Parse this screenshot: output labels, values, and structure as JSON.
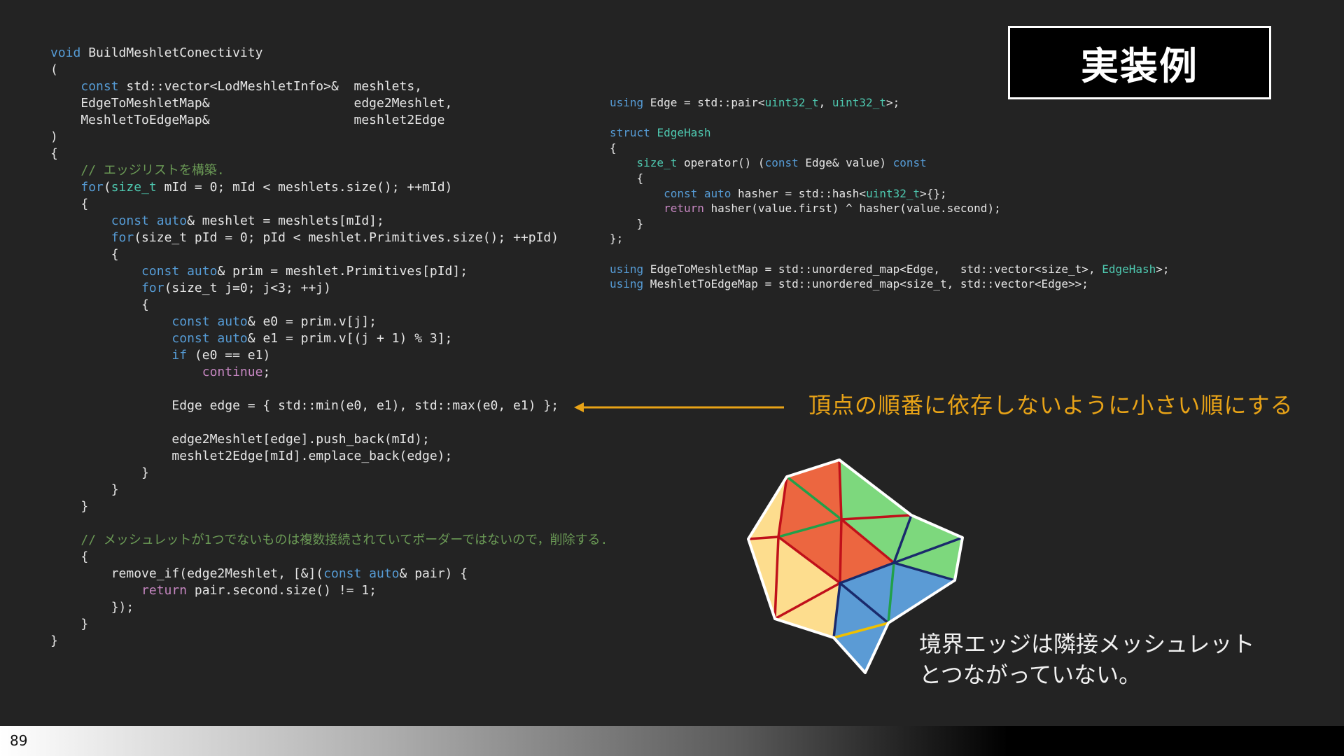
{
  "slide": {
    "title": "実装例",
    "page_number": "89"
  },
  "left_code": {
    "lines": [
      [
        {
          "t": "void",
          "c": "kw"
        },
        {
          "t": " BuildMeshletConectivity"
        }
      ],
      [
        {
          "t": "("
        }
      ],
      [
        {
          "t": "    "
        },
        {
          "t": "const",
          "c": "kw"
        },
        {
          "t": " std::vector<LodMeshletInfo>&  meshlets,"
        }
      ],
      [
        {
          "t": "    EdgeToMeshletMap&                   edge2Meshlet,"
        }
      ],
      [
        {
          "t": "    MeshletToEdgeMap&                   meshlet2Edge"
        }
      ],
      [
        {
          "t": ")"
        }
      ],
      [
        {
          "t": "{"
        }
      ],
      [
        {
          "t": "    "
        },
        {
          "t": "// エッジリストを構築.",
          "c": "cm"
        }
      ],
      [
        {
          "t": "    "
        },
        {
          "t": "for",
          "c": "kw"
        },
        {
          "t": "("
        },
        {
          "t": "size_t",
          "c": "ty"
        },
        {
          "t": " mId = 0; mId < meshlets.size(); ++mId)"
        }
      ],
      [
        {
          "t": "    {"
        }
      ],
      [
        {
          "t": "        "
        },
        {
          "t": "const",
          "c": "kw"
        },
        {
          "t": " "
        },
        {
          "t": "auto",
          "c": "kw"
        },
        {
          "t": "& meshlet = meshlets[mId];"
        }
      ],
      [
        {
          "t": "        "
        },
        {
          "t": "for",
          "c": "kw"
        },
        {
          "t": "(size_t pId = 0; pId < meshlet.Primitives.size(); ++pId)"
        }
      ],
      [
        {
          "t": "        {"
        }
      ],
      [
        {
          "t": "            "
        },
        {
          "t": "const",
          "c": "kw"
        },
        {
          "t": " "
        },
        {
          "t": "auto",
          "c": "kw"
        },
        {
          "t": "& prim = meshlet.Primitives[pId];"
        }
      ],
      [
        {
          "t": "            "
        },
        {
          "t": "for",
          "c": "kw"
        },
        {
          "t": "(size_t j=0; j<3; ++j)"
        }
      ],
      [
        {
          "t": "            {"
        }
      ],
      [
        {
          "t": "                "
        },
        {
          "t": "const",
          "c": "kw"
        },
        {
          "t": " "
        },
        {
          "t": "auto",
          "c": "kw"
        },
        {
          "t": "& e0 = prim.v[j];"
        }
      ],
      [
        {
          "t": "                "
        },
        {
          "t": "const",
          "c": "kw"
        },
        {
          "t": " "
        },
        {
          "t": "auto",
          "c": "kw"
        },
        {
          "t": "& e1 = prim.v[(j + 1) % 3];"
        }
      ],
      [
        {
          "t": "                "
        },
        {
          "t": "if",
          "c": "kw"
        },
        {
          "t": " (e0 == e1)"
        }
      ],
      [
        {
          "t": "                    "
        },
        {
          "t": "continue",
          "c": "ctl"
        },
        {
          "t": ";"
        }
      ],
      [
        {
          "t": ""
        }
      ],
      [
        {
          "t": "                Edge edge = { std::min(e0, e1), std::max(e0, e1) };"
        }
      ],
      [
        {
          "t": ""
        }
      ],
      [
        {
          "t": "                edge2Meshlet[edge].push_back(mId);"
        }
      ],
      [
        {
          "t": "                meshlet2Edge[mId].emplace_back(edge);"
        }
      ],
      [
        {
          "t": "            }"
        }
      ],
      [
        {
          "t": "        }"
        }
      ],
      [
        {
          "t": "    }"
        }
      ],
      [
        {
          "t": ""
        }
      ],
      [
        {
          "t": "    "
        },
        {
          "t": "// メッシュレットが1つでないものは複数接続されていてボーダーではないので，削除する.",
          "c": "cm"
        }
      ],
      [
        {
          "t": "    {"
        }
      ],
      [
        {
          "t": "        remove_if(edge2Meshlet, [&]("
        },
        {
          "t": "const",
          "c": "kw"
        },
        {
          "t": " "
        },
        {
          "t": "auto",
          "c": "kw"
        },
        {
          "t": "& pair) {"
        }
      ],
      [
        {
          "t": "            "
        },
        {
          "t": "return",
          "c": "ctl"
        },
        {
          "t": " pair.second.size() != 1;"
        }
      ],
      [
        {
          "t": "        });"
        }
      ],
      [
        {
          "t": "    }"
        }
      ],
      [
        {
          "t": "}"
        }
      ]
    ]
  },
  "right_code": {
    "lines": [
      [
        {
          "t": "using",
          "c": "kw"
        },
        {
          "t": " Edge = std::pair<"
        },
        {
          "t": "uint32_t",
          "c": "ty"
        },
        {
          "t": ", "
        },
        {
          "t": "uint32_t",
          "c": "ty"
        },
        {
          "t": ">;"
        }
      ],
      [
        {
          "t": ""
        }
      ],
      [
        {
          "t": "struct",
          "c": "kw"
        },
        {
          "t": " "
        },
        {
          "t": "EdgeHash",
          "c": "ty"
        }
      ],
      [
        {
          "t": "{"
        }
      ],
      [
        {
          "t": "    "
        },
        {
          "t": "size_t",
          "c": "ty"
        },
        {
          "t": " operator() ("
        },
        {
          "t": "const",
          "c": "kw"
        },
        {
          "t": " Edge& value) "
        },
        {
          "t": "const",
          "c": "kw"
        }
      ],
      [
        {
          "t": "    {"
        }
      ],
      [
        {
          "t": "        "
        },
        {
          "t": "const",
          "c": "kw"
        },
        {
          "t": " "
        },
        {
          "t": "auto",
          "c": "kw"
        },
        {
          "t": " hasher = std::hash<"
        },
        {
          "t": "uint32_t",
          "c": "ty"
        },
        {
          "t": ">{};"
        }
      ],
      [
        {
          "t": "        "
        },
        {
          "t": "return",
          "c": "ctl"
        },
        {
          "t": " hasher(value.first) ^ hasher(value.second);"
        }
      ],
      [
        {
          "t": "    }"
        }
      ],
      [
        {
          "t": "};"
        }
      ],
      [
        {
          "t": ""
        }
      ],
      [
        {
          "t": "using",
          "c": "kw"
        },
        {
          "t": " EdgeToMeshletMap = std::unordered_map<Edge,   std::vector<size_t>, "
        },
        {
          "t": "EdgeHash",
          "c": "ty"
        },
        {
          "t": ">;"
        }
      ],
      [
        {
          "t": "using",
          "c": "kw"
        },
        {
          "t": " MeshletToEdgeMap = std::unordered_map<size_t, std::vector<Edge>>;"
        }
      ]
    ]
  },
  "annotations": {
    "vertex_order_note": "頂点の順番に依存しないように小さい順にする",
    "boundary_note_line1": "境界エッジは隣接メッシュレット",
    "boundary_note_line2": "とつながっていない。"
  },
  "colors": {
    "background": "#232323",
    "arrow": "#e8a317",
    "mesh_red": "#ec6640",
    "mesh_green": "#7dd87d",
    "mesh_yellow": "#fddd8e",
    "mesh_blue": "#5b9bd5"
  }
}
